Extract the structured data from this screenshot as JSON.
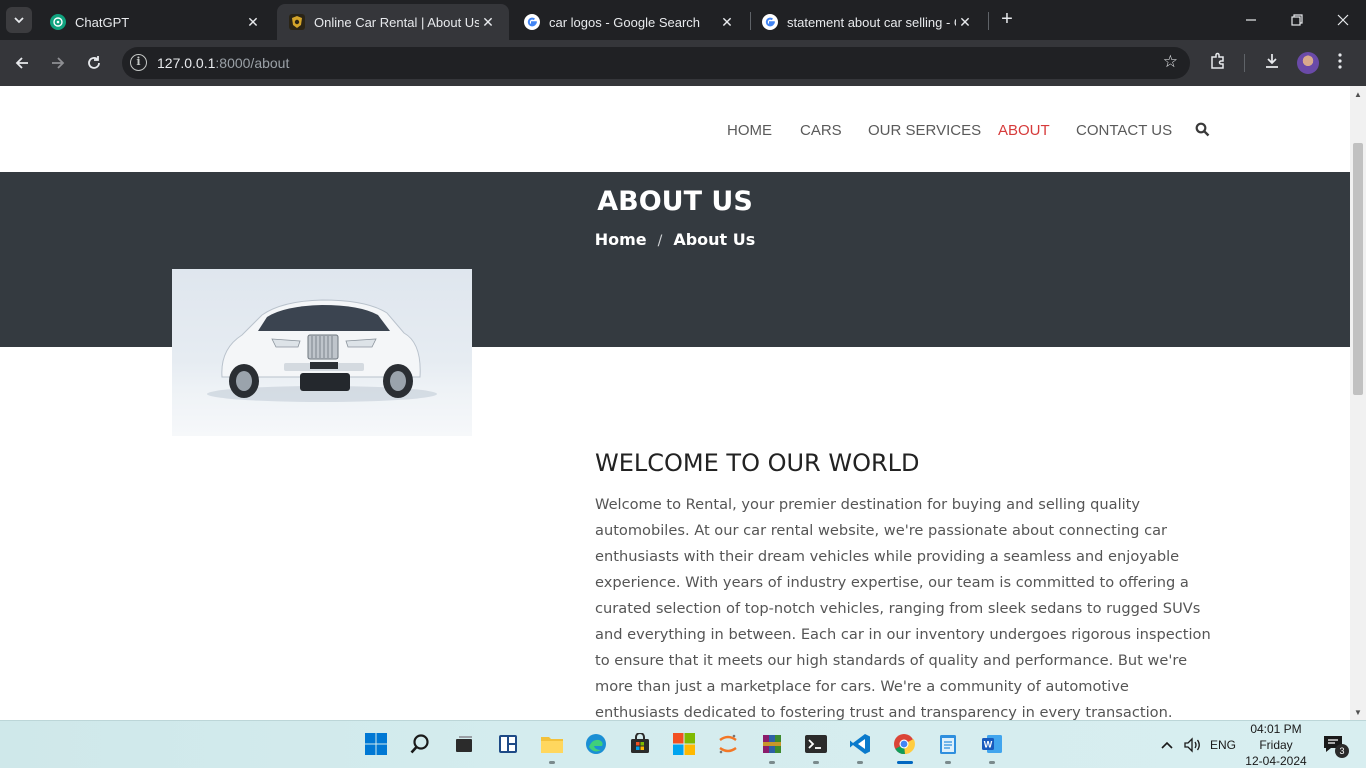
{
  "browser": {
    "tabs": [
      {
        "title": "ChatGPT",
        "active": false,
        "favicon": "chatgpt-icon"
      },
      {
        "title": "Online Car Rental | About Us",
        "active": true,
        "favicon": "site-logo-icon"
      },
      {
        "title": "car logos - Google Search",
        "active": false,
        "favicon": "google-icon"
      },
      {
        "title": "statement about car selling - Go",
        "active": false,
        "favicon": "google-icon"
      }
    ],
    "url_host": "127.0.0.1",
    "url_path": ":8000/about"
  },
  "site": {
    "nav": {
      "items": [
        {
          "label": "HOME",
          "active": false
        },
        {
          "label": "CARS",
          "active": false
        },
        {
          "label": "OUR SERVICES",
          "active": false
        },
        {
          "label": "ABOUT",
          "active": true
        },
        {
          "label": "CONTACT US",
          "active": false
        }
      ],
      "search_icon": "search-icon"
    },
    "hero": {
      "title": "ABOUT US",
      "breadcrumb": {
        "home": "Home",
        "separator": "/",
        "current": "About Us"
      }
    },
    "about": {
      "heading": "WELCOME TO OUR WORLD",
      "body": "Welcome to Rental, your premier destination for buying and selling quality automobiles. At our car rental website, we're passionate about connecting car enthusiasts with their dream vehicles while providing a seamless and enjoyable experience. With years of industry expertise, our team is committed to offering a curated selection of top-notch vehicles, ranging from sleek sedans to rugged SUVs and everything in between. Each car in our inventory undergoes rigorous inspection to ensure that it meets our high standards of quality and performance. But we're more than just a marketplace for cars. We're a community of automotive enthusiasts dedicated to fostering trust and transparency in every transaction. Whether you're a first-time buyer or a seasoned car"
    },
    "colors": {
      "accent": "#d63b3b",
      "hero_bg": "#343a40"
    }
  },
  "taskbar": {
    "apps": [
      "start-icon",
      "search-icon",
      "task-view-icon",
      "widgets-icon",
      "file-explorer-icon",
      "edge-icon",
      "store-icon",
      "office-icon",
      "jupyter-icon",
      "winrar-icon",
      "terminal-icon",
      "vscode-icon",
      "chrome-icon",
      "notepad-icon",
      "word-icon"
    ],
    "language": "ENG",
    "time": "04:01 PM",
    "day": "Friday",
    "date": "12-04-2024",
    "notification_count": "3"
  }
}
